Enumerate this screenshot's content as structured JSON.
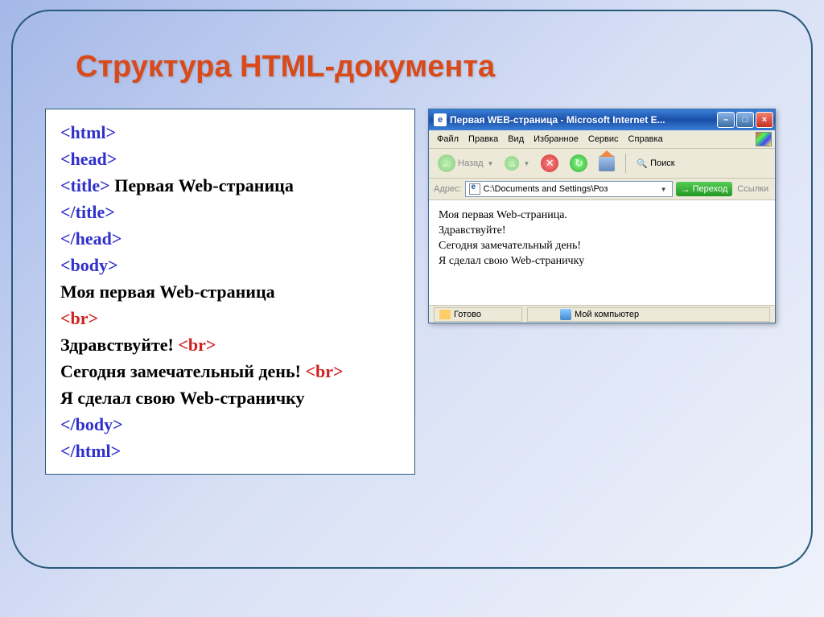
{
  "slide": {
    "title": "Структура HTML-документа"
  },
  "code": {
    "l1": "<html>",
    "l2": "<head>",
    "l3a": "<title>",
    "l3b": " Первая  Web-страница",
    "l4": "</title>",
    "l5": "</head>",
    "l6": "<body>",
    "l7": "Моя первая Web-страница",
    "l8": "<br>",
    "l9a": "Здравствуйте! ",
    "l9b": "<br>",
    "l10a": "Сегодня замечательный день! ",
    "l10b": "<br>",
    "l11": "Я сделал свою Web-страничку",
    "l12": "</body>",
    "l13": "</html>"
  },
  "browser": {
    "title": "Первая WEB-страница - Microsoft Internet E...",
    "menu": {
      "file": "Файл",
      "edit": "Правка",
      "view": "Вид",
      "favorites": "Избранное",
      "tools": "Сервис",
      "help": "Справка"
    },
    "toolbar": {
      "back": "Назад",
      "search": "Поиск"
    },
    "address": {
      "label": "Адрес:",
      "value": "C:\\Documents and Settings\\Роз",
      "go": "Переход",
      "links": "Ссылки"
    },
    "content": {
      "line1": "Моя первая Web-страница.",
      "line2": "Здравствуйте!",
      "line3": "Сегодня замечательный день!",
      "line4": "Я сделал свою Web-страничку"
    },
    "status": {
      "done": "Готово",
      "zone": "Мой компьютер"
    }
  }
}
